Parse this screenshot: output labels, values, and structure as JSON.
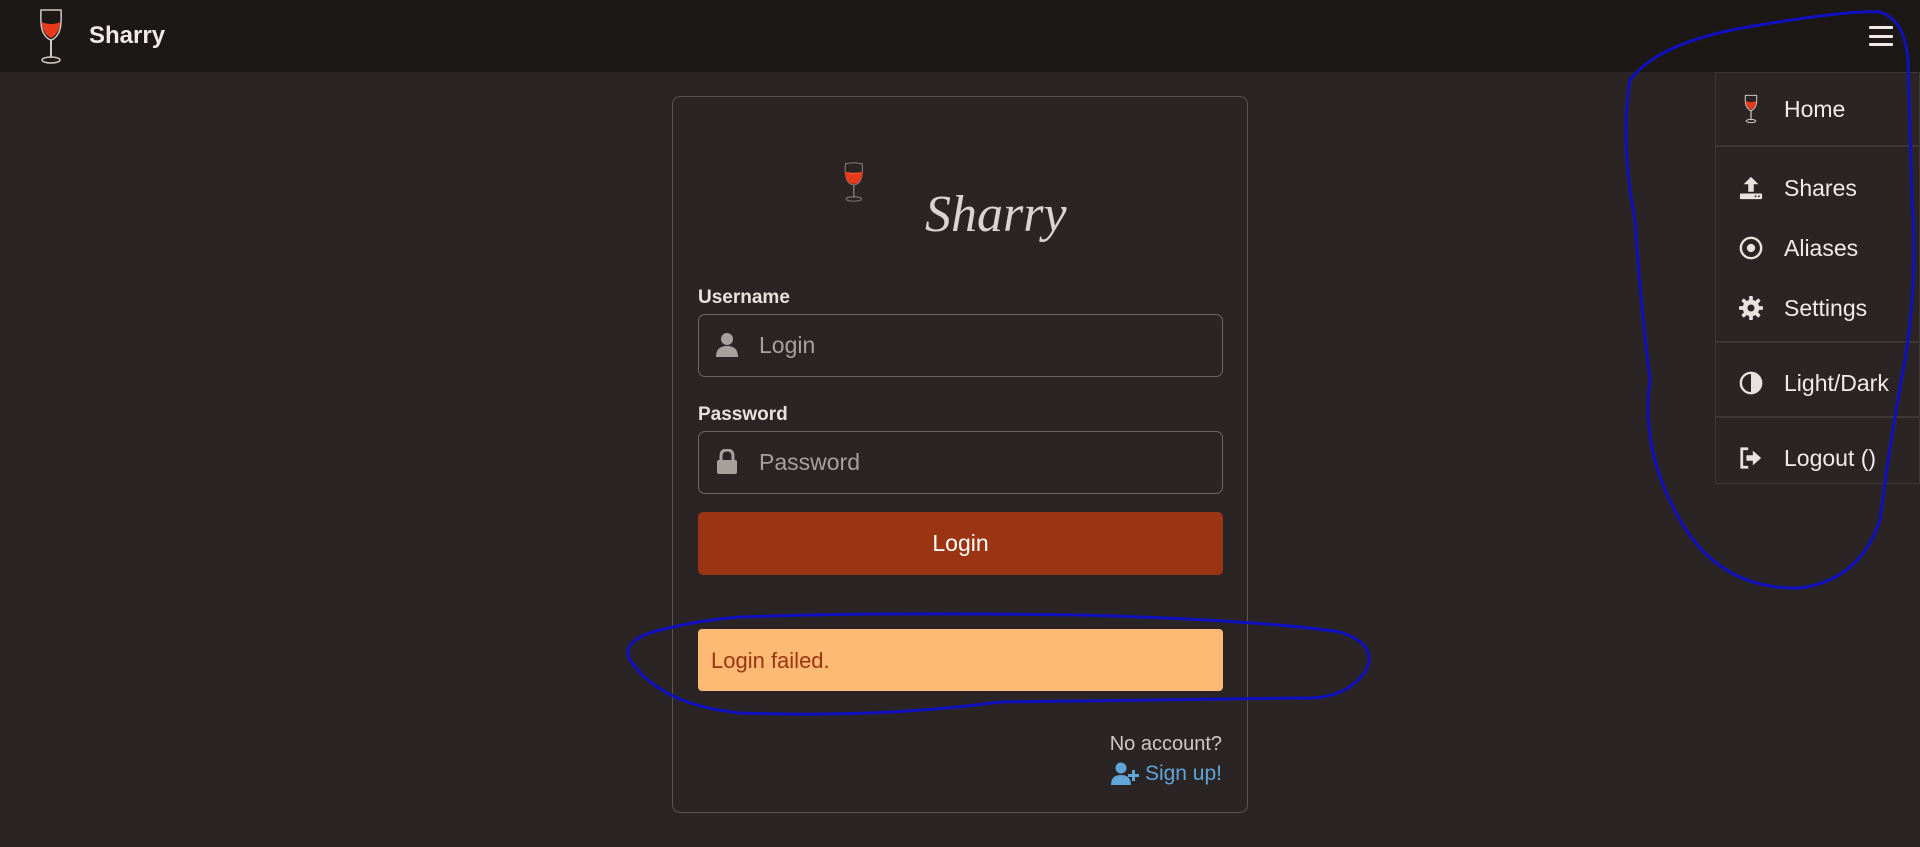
{
  "navbar": {
    "title": "Sharry",
    "logo_icon": "wine-glass-icon",
    "menu_icon": "hamburger-icon"
  },
  "login": {
    "brand_text": "Sharry",
    "username_label": "Username",
    "username_placeholder": "Login",
    "password_label": "Password",
    "password_placeholder": "Password",
    "login_button": "Login",
    "error_message": "Login failed.",
    "no_account_text": "No account?",
    "signup_link": "Sign up!"
  },
  "menu": {
    "items": [
      {
        "label": "Home",
        "icon": "wine-glass-icon"
      },
      {
        "label": "Shares",
        "icon": "upload-icon"
      },
      {
        "label": "Aliases",
        "icon": "dot-circle-icon"
      },
      {
        "label": "Settings",
        "icon": "gear-icon"
      },
      {
        "label": "Light/Dark",
        "icon": "contrast-icon"
      },
      {
        "label": "Logout ()",
        "icon": "sign-out-icon"
      }
    ]
  },
  "colors": {
    "background": "#2a2524",
    "navbar": "#1c1816",
    "primary_button": "#9a3412",
    "alert_bg": "#fdba74",
    "alert_text": "#9a3412",
    "link": "#60a5d8",
    "annotation": "#1010c0"
  }
}
